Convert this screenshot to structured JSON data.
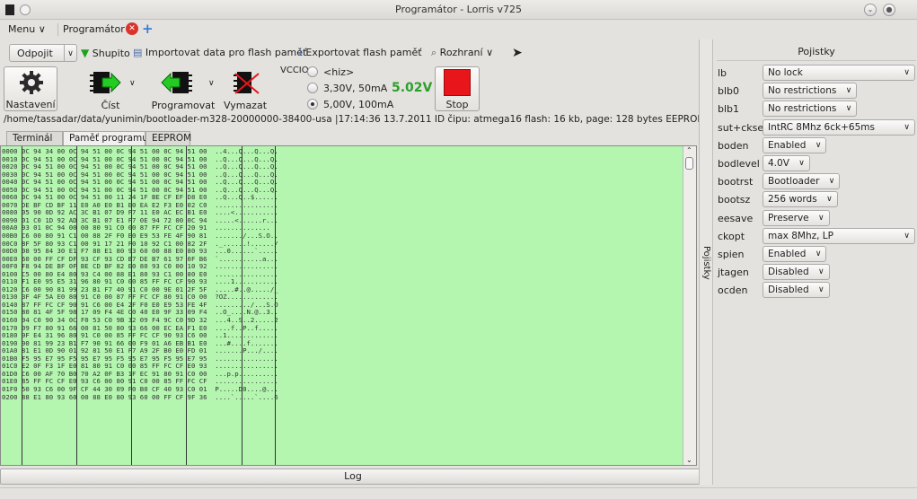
{
  "window": {
    "title": "Programátor - Lorris v725"
  },
  "menubar": {
    "menu_label": "Menu ∨",
    "tab_label": "Programátor",
    "close_glyph": "✕",
    "add_glyph": "+"
  },
  "toolbar": {
    "connect": "Odpojit",
    "chip": "Shupito",
    "import_flash": "Importovat data pro flash paměť",
    "export_flash": "Exportovat flash paměť",
    "interface": "Rozhraní ∨"
  },
  "buttons": {
    "settings": "Nastavení",
    "read": "Číst",
    "program": "Programovat",
    "erase": "Vymazat",
    "stop": "Stop"
  },
  "vcc": {
    "label": "VCCIO",
    "options": [
      "<hiz>",
      "3,30V, 50mA",
      "5,00V, 100mA"
    ],
    "selected_index": 2,
    "voltage_readout": "5.02V"
  },
  "status": {
    "path_line": "/home/tassadar/data/yunimin/bootloader-m328-20000000-38400-usa  |17:14:36 13.7.2011 ID čipu: atmega16 flash: 16 kb, page: 128 bytes  EEPROM: 512 bytes"
  },
  "tabs": [
    "Terminál",
    "Paměť programu",
    "EEPROM"
  ],
  "hex": {
    "rows": [
      [
        "0000",
        "0C 94 34 00",
        "0C 94 51 00",
        "0C 94 51 00",
        "0C 94 51 00",
        "..4...Q...Q...Q."
      ],
      [
        "0010",
        "0C 94 51 00",
        "0C 94 51 00",
        "0C 94 51 00",
        "0C 94 51 00",
        "..Q...Q...Q...Q."
      ],
      [
        "0020",
        "0C 94 51 00",
        "0C 94 51 00",
        "0C 94 51 00",
        "0C 94 51 00",
        "..Q...Q...Q...Q."
      ],
      [
        "0030",
        "0C 94 51 00",
        "0C 94 51 00",
        "0C 94 51 00",
        "0C 94 51 00",
        "..Q...Q...Q...Q."
      ],
      [
        "0040",
        "0C 94 51 00",
        "0C 94 51 00",
        "0C 94 51 00",
        "0C 94 51 00",
        "..Q...Q...Q...Q."
      ],
      [
        "0050",
        "0C 94 51 00",
        "0C 94 51 00",
        "0C 94 51 00",
        "0C 94 51 00",
        "..Q...Q...Q...Q."
      ],
      [
        "0060",
        "0C 94 51 00",
        "0C 94 51 00",
        "11 24 1F BE",
        "CF EF D8 E0",
        "..Q...Q..$......"
      ],
      [
        "0070",
        "DE BF CD BF",
        "11 E0 A0 E0",
        "B1 E0 EA E2",
        "F3 E0 02 C0",
        "................"
      ],
      [
        "0080",
        "05 90 0D 92",
        "AC 3C B1 07",
        "D9 F7 11 E0",
        "AC EC B1 E0",
        "....<..........."
      ],
      [
        "0090",
        "01 C0 1D 92",
        "AD 3C B1 07",
        "E1 F7 0E 94",
        "72 00 0C 94",
        ".....<......r..."
      ],
      [
        "00A0",
        "93 01 0C 94",
        "00 00 80 91",
        "C0 00 87 FF",
        "FC CF 20 91",
        "..............  "
      ],
      [
        "00B0",
        "C6 00 80 91",
        "C1 00 88 2F",
        "F0 E0 E9 53",
        "FE 4F 90 81",
        "......./...S.O.."
      ],
      [
        "00C0",
        "8F 5F 80 93",
        "C1 00 91 17",
        "21 F0 10 92",
        "C1 00 82 2F",
        "._......!....../"
      ],
      [
        "00D0",
        "08 95 84 30",
        "E1 F7 88 E1",
        "80 93 60 00",
        "88 E0 80 93",
        "...0......`....."
      ],
      [
        "00E0",
        "60 00 FF CF",
        "DF 93 CF 93",
        "CD B7 DE B7",
        "61 97 0F B6",
        "`...........a..."
      ],
      [
        "00F0",
        "F8 94 DE BF",
        "0F BE CD BF",
        "82 E0 80 93",
        "C0 00 10 92",
        "................"
      ],
      [
        "0100",
        "C5 00 80 E4",
        "80 93 C4 00",
        "88 E1 80 93",
        "C1 00 80 E0",
        "................"
      ],
      [
        "0110",
        "F1 E0 95 E5",
        "31 96 80 91",
        "C0 00 85 FF",
        "FC CF 90 93",
        "....1..........."
      ],
      [
        "0120",
        "C6 00 90 81",
        "99 23 B1 F7",
        "40 91 C0 00",
        "9E 01 2F 5F",
        ".....#..@...../_"
      ],
      [
        "0130",
        "3F 4F 5A E0",
        "80 91 C0 00",
        "87 FF FC CF",
        "80 91 C0 00",
        "?OZ............."
      ],
      [
        "0140",
        "87 FF FC CF",
        "90 91 C6 00",
        "E4 2F F0 E0",
        "E9 53 FE 4F",
        "........./...S.O"
      ],
      [
        "0150",
        "80 81 4F 5F",
        "98 17 09 F4",
        "4E C0 40 E0",
        "9F 33 09 F4",
        "..O_....N.@..3.."
      ],
      [
        "0160",
        "94 C0 90 34",
        "0C F0 53 C0",
        "9B 32 09 F4",
        "9C C0 9D 32",
        "...4..S..2.....2"
      ],
      [
        "0170",
        "09 F7 80 91",
        "66 00 81 50",
        "80 93 66 00",
        "EC EA F1 E0",
        "....f..P..f....."
      ],
      [
        "0180",
        "9F E4 31 96",
        "80 91 C0 00",
        "85 FF FC CF",
        "90 93 C6 00",
        "..1............."
      ],
      [
        "0190",
        "90 81 99 23",
        "B1 F7 90 91",
        "66 00 F9 01",
        "A6 EB B1 E0",
        "...#....f......."
      ],
      [
        "01A0",
        "81 E1 0D 90",
        "01 92 81 50",
        "E1 F7 A9 2F",
        "B0 E0 FD 01",
        ".......P.../...."
      ],
      [
        "01B0",
        "F5 95 E7 95",
        "F5 95 E7 95",
        "F5 95 E7 95",
        "F5 95 E7 95",
        "................"
      ],
      [
        "01C0",
        "E2 0F F3 1F",
        "E0 81 80 91",
        "C0 00 85 FF",
        "FC CF E0 93",
        "................"
      ],
      [
        "01D0",
        "C6 00 AF 70",
        "B0 70 A2 0F",
        "B3 1F EC 91",
        "80 91 C0 00",
        "...p.p.........."
      ],
      [
        "01E0",
        "85 FF FC CF",
        "E0 93 C6 00",
        "80 91 C0 00",
        "85 FF FC CF",
        "................"
      ],
      [
        "01F0",
        "50 93 C6 00",
        "9F CF 44 30",
        "09 F0 B0 CF",
        "40 93 C0 01",
        "P.....D0....@..."
      ],
      [
        "0200",
        "88 E1 80 93",
        "60 00 88 E0",
        "80 93 60 00",
        "FF CF 9F 36",
        "....`.....`....6"
      ]
    ]
  },
  "log": {
    "label": "Log"
  },
  "fuses_panel": {
    "side_label": "Pojistky",
    "title": "Pojistky",
    "rows": [
      {
        "name": "lb",
        "value": "No lock",
        "wide": true
      },
      {
        "name": "blb0",
        "value": "No restrictions",
        "wide": false
      },
      {
        "name": "blb1",
        "value": "No restrictions",
        "wide": false
      },
      {
        "name": "sut+cksel",
        "value": "IntRC 8Mhz 6ck+65ms",
        "wide": true
      },
      {
        "name": "boden",
        "value": "Enabled",
        "wide": false
      },
      {
        "name": "bodlevel",
        "value": "4.0V",
        "wide": false
      },
      {
        "name": "bootrst",
        "value": "Bootloader",
        "wide": false
      },
      {
        "name": "bootsz",
        "value": "256 words",
        "wide": false
      },
      {
        "name": "eesave",
        "value": "Preserve",
        "wide": false
      },
      {
        "name": "ckopt",
        "value": "max 8Mhz, LP",
        "wide": true
      },
      {
        "name": "spien",
        "value": "Enabled",
        "wide": false
      },
      {
        "name": "jtagen",
        "value": "Disabled",
        "wide": false
      },
      {
        "name": "ocden",
        "value": "Disabled",
        "wide": false
      }
    ]
  },
  "colors": {
    "hex_background": "#b4f5b0",
    "voltage_text": "#2aa12a",
    "stop_red": "#e8161b",
    "tab_close_red": "#d9342b"
  }
}
